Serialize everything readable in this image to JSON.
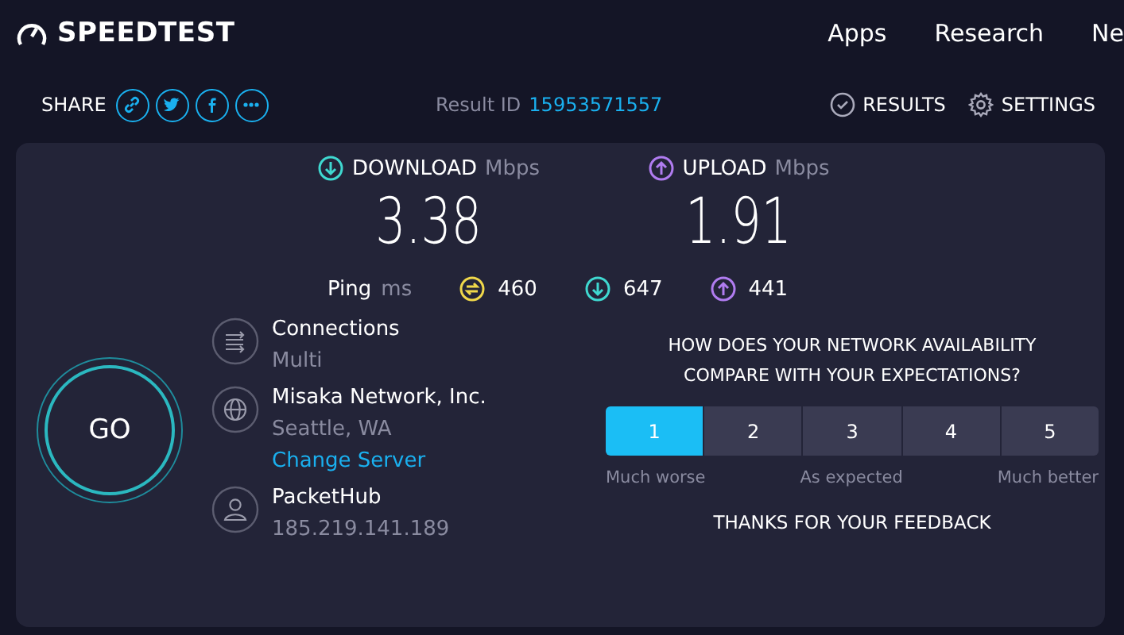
{
  "logo": "SPEEDTEST",
  "nav": [
    "Apps",
    "Research",
    "Ne"
  ],
  "share": {
    "label": "SHARE",
    "buttons": [
      {
        "kind": "link"
      },
      {
        "kind": "twitter"
      },
      {
        "kind": "facebook"
      },
      {
        "kind": "more"
      }
    ]
  },
  "result": {
    "label": "Result ID",
    "id": "15953571557"
  },
  "actions": [
    {
      "kind": "results",
      "label": "RESULTS"
    },
    {
      "kind": "settings",
      "label": "SETTINGS"
    }
  ],
  "metrics": [
    {
      "kind": "download",
      "label": "DOWNLOAD",
      "unit": "Mbps",
      "value": "3.38"
    },
    {
      "kind": "upload",
      "label": "UPLOAD",
      "unit": "Mbps",
      "value": "1.91"
    }
  ],
  "ping": {
    "label": "Ping",
    "unit": "ms",
    "items": [
      {
        "kind": "jitter",
        "value": "460"
      },
      {
        "kind": "download",
        "value": "647"
      },
      {
        "kind": "upload",
        "value": "441"
      }
    ]
  },
  "go": "GO",
  "info": [
    {
      "kind": "connections",
      "title": "Connections",
      "sub": "Multi"
    },
    {
      "kind": "server",
      "title": "Misaka Network, Inc.",
      "sub": "Seattle, WA",
      "link": "Change Server"
    },
    {
      "kind": "provider",
      "title": "PacketHub",
      "sub": "185.219.141.189"
    }
  ],
  "survey": {
    "question": "HOW DOES YOUR NETWORK AVAILABILITY COMPARE WITH YOUR EXPECTATIONS?",
    "options": [
      {
        "label": "1",
        "selected": true
      },
      {
        "label": "2",
        "selected": false
      },
      {
        "label": "3",
        "selected": false
      },
      {
        "label": "4",
        "selected": false
      },
      {
        "label": "5",
        "selected": false
      }
    ],
    "scale": [
      "Much worse",
      "As expected",
      "Much better"
    ],
    "thanks": "THANKS FOR YOUR FEEDBACK"
  }
}
